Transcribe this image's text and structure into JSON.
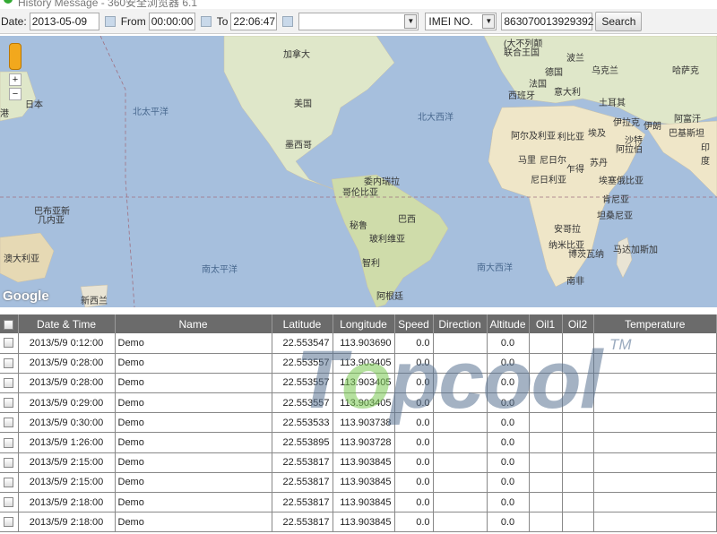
{
  "window": {
    "title": "History Message - 360安全浏览器 6.1"
  },
  "toolbar": {
    "date_label": "Date:",
    "date": "2013-05-09",
    "from_label": "From",
    "from_time": "00:00:00",
    "to_label": "To",
    "to_time": "22:06:47",
    "device_select": "",
    "id_type": "IMEI NO.",
    "imei": "863070013929392",
    "search_label": "Search"
  },
  "map": {
    "zoom_in": "+",
    "zoom_out": "−",
    "logo": "Google",
    "labels": {
      "japan": "日本",
      "hk": "港",
      "canada": "加拿大",
      "usa": "美国",
      "mexico": "墨西哥",
      "npac": "北太平洋",
      "natl": "北大西洋",
      "venezuela": "委内瑞拉",
      "colombia": "哥伦比亚",
      "peru": "秘鲁",
      "brazil": "巴西",
      "bolivia": "玻利维亚",
      "chile": "智利",
      "argentina": "阿根廷",
      "spac": "南太平洋",
      "satl": "南大西洋",
      "png": "巴布亚新",
      "png2": "几内亚",
      "australia": "澳大利亚",
      "nz": "新西兰",
      "uk": "(大不列颠",
      "uk2": "联合王国",
      "germany": "德国",
      "poland": "波兰",
      "ukraine": "乌克兰",
      "kaz": "哈萨克",
      "france": "法国",
      "spain": "西班牙",
      "italy": "意大利",
      "turkey": "土耳其",
      "algeria": "阿尔及利亚",
      "libya": "利比亚",
      "egypt": "埃及",
      "iraq": "伊拉克",
      "iran": "伊朗",
      "saudi": "沙特",
      "saudi2": "阿拉伯",
      "afg": "阿富汗",
      "pak": "巴基斯坦",
      "india": "印度",
      "mali": "马里",
      "niger": "尼日尔",
      "chad": "乍得",
      "sudan": "苏丹",
      "nigeria": "尼日利亚",
      "ethiopia": "埃塞俄比亚",
      "kenya": "肯尼亚",
      "tanzania": "坦桑尼亚",
      "angola": "安哥拉",
      "namibia": "纳米比亚",
      "botswana": "博茨瓦纳",
      "madagascar": "马达加斯加",
      "sa": "南非"
    }
  },
  "table": {
    "columns": [
      "Date & Time",
      "Name",
      "Latitude",
      "Longitude",
      "Speed",
      "Direction",
      "Altitude",
      "Oil1",
      "Oil2",
      "Temperature"
    ],
    "rows": [
      [
        "2013/5/9 0:12:00",
        "Demo",
        "22.553547",
        "113.903690",
        "0.0",
        "",
        "0.0",
        "",
        "",
        ""
      ],
      [
        "2013/5/9 0:28:00",
        "Demo",
        "22.553557",
        "113.903405",
        "0.0",
        "",
        "0.0",
        "",
        "",
        ""
      ],
      [
        "2013/5/9 0:28:00",
        "Demo",
        "22.553557",
        "113.903405",
        "0.0",
        "",
        "0.0",
        "",
        "",
        ""
      ],
      [
        "2013/5/9 0:29:00",
        "Demo",
        "22.553557",
        "113.903405",
        "0.0",
        "",
        "0.0",
        "",
        "",
        ""
      ],
      [
        "2013/5/9 0:30:00",
        "Demo",
        "22.553533",
        "113.903738",
        "0.0",
        "",
        "0.0",
        "",
        "",
        ""
      ],
      [
        "2013/5/9 1:26:00",
        "Demo",
        "22.553895",
        "113.903728",
        "0.0",
        "",
        "0.0",
        "",
        "",
        ""
      ],
      [
        "2013/5/9 2:15:00",
        "Demo",
        "22.553817",
        "113.903845",
        "0.0",
        "",
        "0.0",
        "",
        "",
        ""
      ],
      [
        "2013/5/9 2:15:00",
        "Demo",
        "22.553817",
        "113.903845",
        "0.0",
        "",
        "0.0",
        "",
        "",
        ""
      ],
      [
        "2013/5/9 2:18:00",
        "Demo",
        "22.553817",
        "113.903845",
        "0.0",
        "",
        "0.0",
        "",
        "",
        ""
      ],
      [
        "2013/5/9 2:18:00",
        "Demo",
        "22.553817",
        "113.903845",
        "0.0",
        "",
        "0.0",
        "",
        "",
        ""
      ]
    ]
  },
  "watermark": {
    "text1": "T",
    "text2": "o",
    "text3": "pcool",
    "tm": "TM"
  }
}
